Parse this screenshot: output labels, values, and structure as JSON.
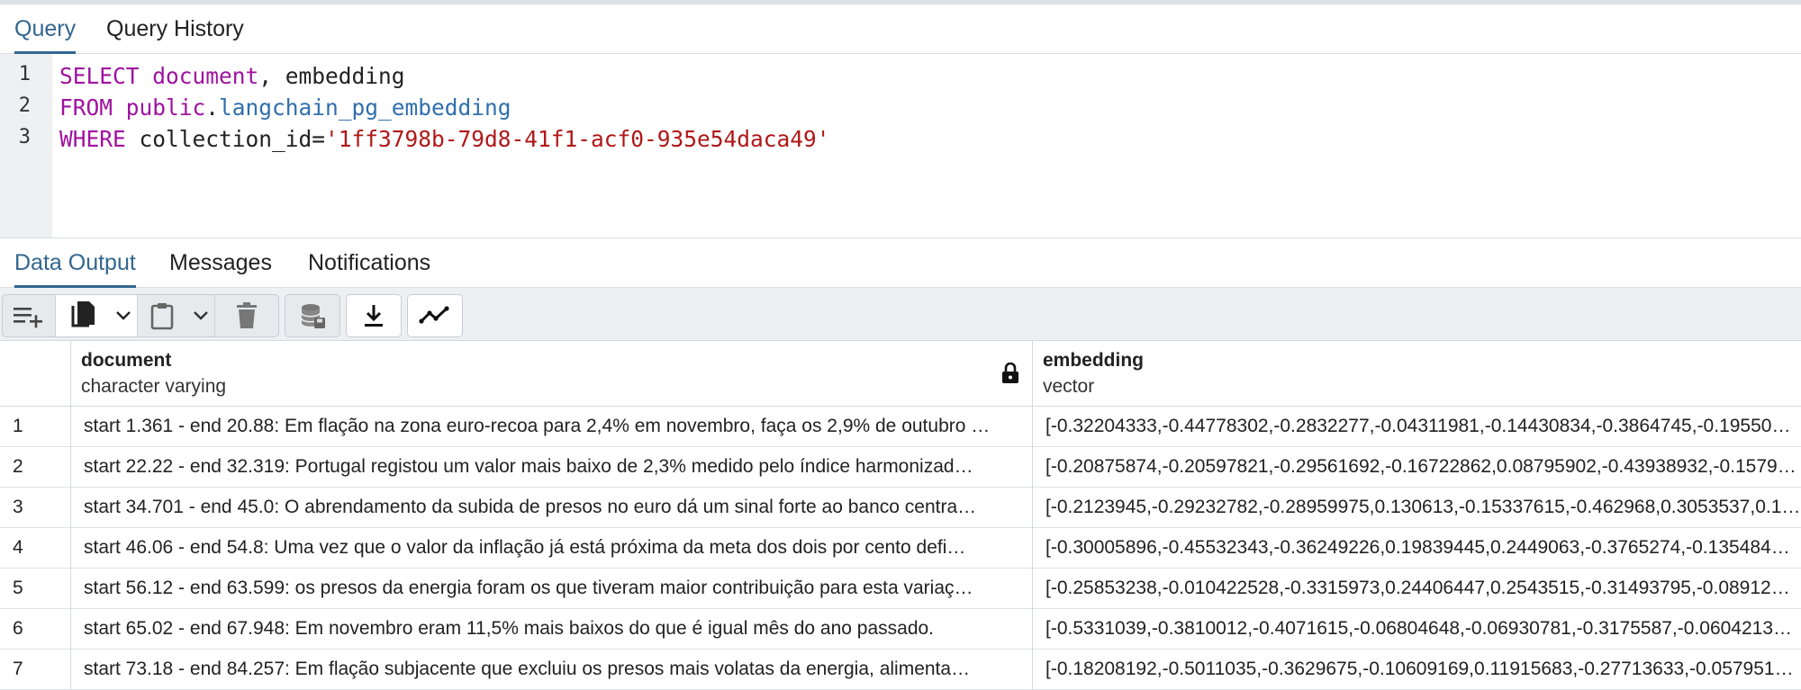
{
  "query_tabs": [
    {
      "label": "Query",
      "active": true
    },
    {
      "label": "Query History",
      "active": false
    }
  ],
  "editor": {
    "line_numbers": [
      "1",
      "2",
      "3"
    ],
    "lines": [
      [
        {
          "t": "SELECT ",
          "c": "kw"
        },
        {
          "t": "document",
          "c": "kw"
        },
        {
          "t": ", embedding",
          "c": ""
        }
      ],
      [
        {
          "t": "FROM ",
          "c": "kw"
        },
        {
          "t": "public",
          "c": "kw"
        },
        {
          "t": ".",
          "c": ""
        },
        {
          "t": "langchain_pg_embedding",
          "c": "fn"
        }
      ],
      [
        {
          "t": "WHERE ",
          "c": "kw"
        },
        {
          "t": "collection_id=",
          "c": ""
        },
        {
          "t": "'1ff3798b-79d8-41f1-acf0-935e54daca49'",
          "c": "str"
        }
      ]
    ]
  },
  "output_tabs": [
    {
      "label": "Data Output",
      "active": true
    },
    {
      "label": "Messages",
      "active": false
    },
    {
      "label": "Notifications",
      "active": false
    }
  ],
  "toolbar": {
    "icons": [
      "add-row-icon",
      "copy-icon",
      "chevron-down-icon",
      "paste-icon",
      "chevron-down-icon",
      "delete-icon",
      "save-data-icon",
      "download-icon",
      "graph-icon"
    ]
  },
  "grid": {
    "columns": [
      {
        "name": "document",
        "type": "character varying",
        "locked": true
      },
      {
        "name": "embedding",
        "type": "vector",
        "locked": false
      }
    ],
    "rows": [
      {
        "num": "1",
        "document": "start 1.361 - end 20.88:  Em flação na zona euro-recoa para 2,4% em novembro, faça os 2,9% de outubro …",
        "embedding": "[-0.32204333,-0.44778302,-0.2832277,-0.04311981,-0.14430834,-0.3864745,-0.19550…"
      },
      {
        "num": "2",
        "document": "start 22.22 - end 32.319:  Portugal registou um valor mais baixo de 2,3% medido pelo índice harmonizad…",
        "embedding": "[-0.20875874,-0.20597821,-0.29561692,-0.16722862,0.08795902,-0.43938932,-0.1579…"
      },
      {
        "num": "3",
        "document": "start 34.701 - end 45.0:  O abrendamento da subida de presos no euro dá um sinal forte ao banco centra…",
        "embedding": "[-0.2123945,-0.29232782,-0.28959975,0.130613,-0.15337615,-0.462968,0.3053537,0.1…"
      },
      {
        "num": "4",
        "document": "start 46.06 - end 54.8:  Uma vez que o valor da inflação já está próxima da meta dos dois por cento defi…",
        "embedding": "[-0.30005896,-0.45532343,-0.36249226,0.19839445,0.2449063,-0.3765274,-0.135484…"
      },
      {
        "num": "5",
        "document": "start 56.12 - end 63.599:  os presos da energia foram os que tiveram maior contribuição para esta variaç…",
        "embedding": "[-0.25853238,-0.010422528,-0.3315973,0.24406447,0.2543515,-0.31493795,-0.08912…"
      },
      {
        "num": "6",
        "document": "start 65.02 - end 67.948:  Em novembro eram 11,5% mais baixos do que é igual mês do ano passado.",
        "embedding": "[-0.5331039,-0.3810012,-0.4071615,-0.06804648,-0.06930781,-0.3175587,-0.0604213…"
      },
      {
        "num": "7",
        "document": "start 73.18 - end 84.257:  Em flação subjacente que excluiu os presos mais volatas da energia, alimenta…",
        "embedding": "[-0.18208192,-0.5011035,-0.3629675,-0.10609169,0.11915683,-0.27713633,-0.057951…"
      }
    ]
  }
}
